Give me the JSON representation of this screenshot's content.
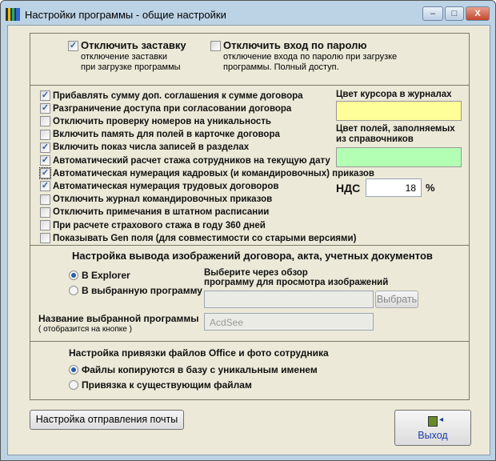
{
  "window": {
    "title": "Настройки программы - общие настройки",
    "minimize": "–",
    "maximize": "□",
    "close": "X"
  },
  "top": {
    "splash": {
      "label": "Отключить заставку",
      "desc1": "отключение заставки",
      "desc2": "при загрузке программы",
      "checked": true
    },
    "password": {
      "label": "Отключить вход по паролю",
      "desc1": "отключение входа по паролю при загрузке",
      "desc2": "программы. Полный доступ.",
      "checked": false
    }
  },
  "options": [
    {
      "label": "Прибавлять сумму доп. соглашения к сумме договора",
      "checked": true
    },
    {
      "label": "Разграничение доступа при согласовании договора",
      "checked": true
    },
    {
      "label": "Отключить проверку номеров на уникальность",
      "checked": false
    },
    {
      "label": "Включить память для полей в карточке договора",
      "checked": false
    },
    {
      "label": "Включить показ числа записей в разделах",
      "checked": true
    },
    {
      "label": "Автоматический расчет стажа сотрудников на текущую дату",
      "checked": true
    },
    {
      "label": "Автоматическая нумерация кадровых (и командировочных) приказов",
      "checked": true
    },
    {
      "label": "Автоматическая нумерация трудовых договоров",
      "checked": true
    },
    {
      "label": "Отключить журнал командировочных приказов",
      "checked": false
    },
    {
      "label": "Отключить примечания в штатном расписании",
      "checked": false
    },
    {
      "label": "При расчете страхового стажа в году 360 дней",
      "checked": false
    },
    {
      "label": "Показывать Gen поля (для совместимости со старыми версиями)",
      "checked": false
    }
  ],
  "colors": {
    "cursor_label": "Цвет курсора в журналах",
    "cursor_color": "#ffff99",
    "fields_label1": "Цвет полей, заполняемых",
    "fields_label2": "из справочников",
    "fields_color": "#b3ffb3"
  },
  "vat": {
    "label": "НДС",
    "value": "18",
    "unit": "%"
  },
  "images": {
    "title": "Настройка вывода изображений договора,  акта, учетных документов",
    "radio_explorer": "В Explorer",
    "radio_program": "В выбранную программу",
    "browse_label1": "Выберите через обзор",
    "browse_label2": "программу для просмотра изображений",
    "path_value": "",
    "browse_button": "Выбрать",
    "name_label": "Название выбранной программы",
    "name_sub": "( отобразится на кнопке )",
    "name_value": "AcdSee"
  },
  "files": {
    "title": "Настройка привязки файлов Office и фото сотрудника",
    "radio_copy": "Файлы копируются в базу с уникальным именем",
    "radio_link": "Привязка к существующим файлам"
  },
  "buttons": {
    "mail": "Настройка отправления почты",
    "exit": "Выход"
  }
}
